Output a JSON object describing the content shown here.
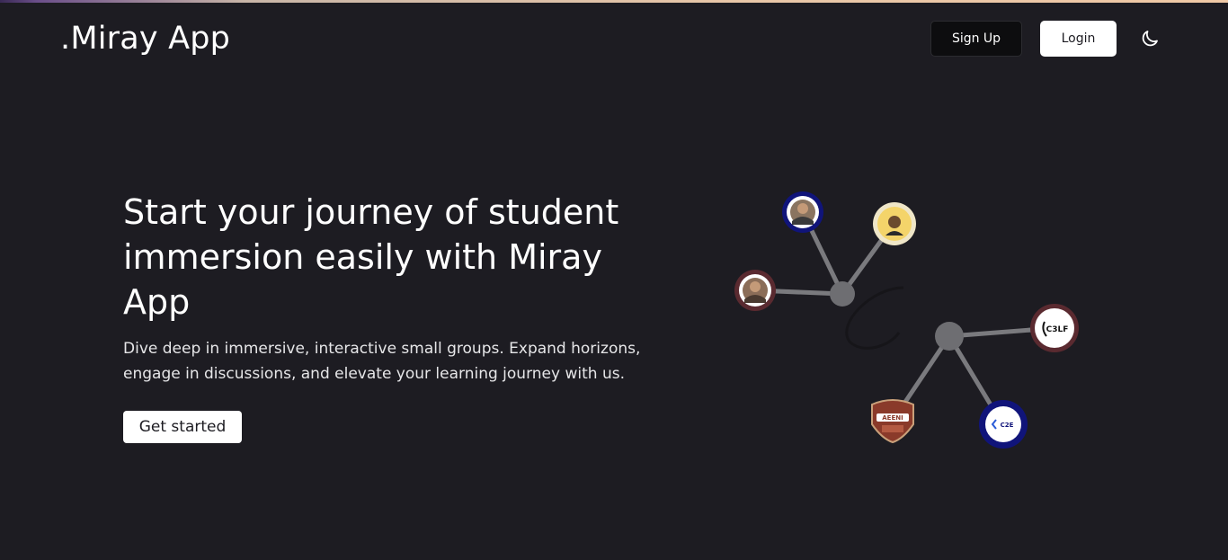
{
  "header": {
    "brand": ".Miray App",
    "signup_label": "Sign Up",
    "login_label": "Login",
    "theme_icon": "moon-icon"
  },
  "hero": {
    "title": "Start your journey of student immersion easily with Miray App",
    "description": "Dive deep in immersive, interactive small groups. Expand horizons, engage in discussions, and elevate your learning journey with us.",
    "cta_label": "Get started"
  },
  "network": {
    "nodes": [
      {
        "name": "avatar-student-1",
        "kind": "photo"
      },
      {
        "name": "avatar-student-2",
        "kind": "photo"
      },
      {
        "name": "avatar-student-3",
        "kind": "photo"
      },
      {
        "name": "logo-c3lf",
        "text": "C3LF"
      },
      {
        "name": "logo-aeeni",
        "text": "AEENI"
      },
      {
        "name": "logo-c2e",
        "text": "C2E"
      }
    ]
  },
  "colors": {
    "background": "#1d1c22",
    "hub": "#6e6e72",
    "ring_navy": "#10147a",
    "ring_maroon": "#5a2a30"
  }
}
